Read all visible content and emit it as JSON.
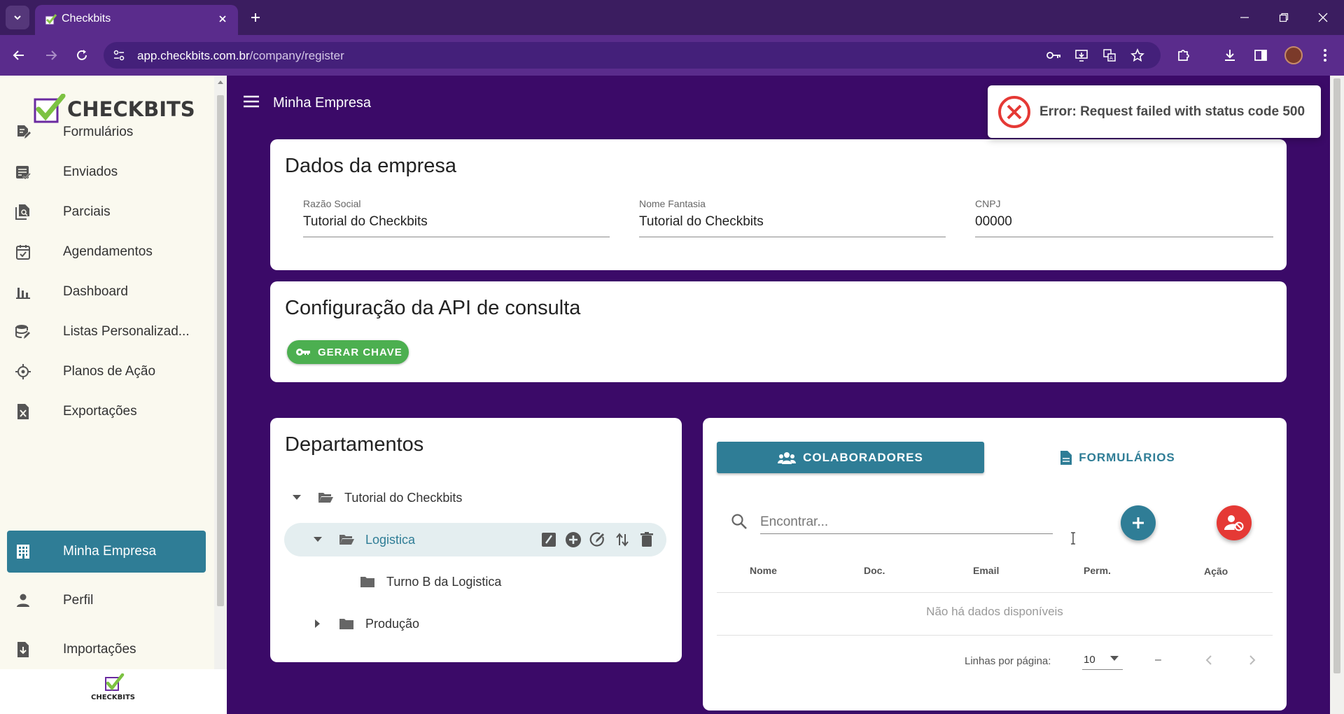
{
  "browser": {
    "tab_title": "Checkbits",
    "url_host": "app.checkbits.com.br",
    "url_path": "/company/register"
  },
  "sidebar": {
    "brand": "CHECKBITS",
    "items": [
      {
        "label": "Formulários",
        "icon": "form-edit-icon"
      },
      {
        "label": "Enviados",
        "icon": "sent-list-icon"
      },
      {
        "label": "Parciais",
        "icon": "partial-docs-icon"
      },
      {
        "label": "Agendamentos",
        "icon": "calendar-check-icon"
      },
      {
        "label": "Dashboard",
        "icon": "bar-chart-icon"
      },
      {
        "label": "Listas Personalizad...",
        "icon": "database-edit-icon"
      },
      {
        "label": "Planos de Ação",
        "icon": "crosshair-icon"
      },
      {
        "label": "Exportações",
        "icon": "excel-file-icon"
      },
      {
        "label": "Minha Empresa",
        "icon": "building-icon",
        "active": true
      },
      {
        "label": "Perfil",
        "icon": "person-icon"
      },
      {
        "label": "Importações",
        "icon": "file-import-icon"
      }
    ],
    "bottom_logo": "CHECKBITS"
  },
  "header": {
    "title": "Minha Empresa"
  },
  "company": {
    "title": "Dados da empresa",
    "fields": [
      {
        "label": "Razão Social",
        "value": "Tutorial do Checkbits"
      },
      {
        "label": "Nome Fantasia",
        "value": "Tutorial do Checkbits"
      },
      {
        "label": "CNPJ",
        "value": "00000"
      }
    ]
  },
  "api": {
    "title": "Configuração da API de consulta",
    "generate_button": "GERAR CHAVE"
  },
  "departments": {
    "title": "Departamentos",
    "tree": [
      {
        "label": "Tutorial do Checkbits",
        "expanded": true,
        "level": 0
      },
      {
        "label": "Logistica",
        "expanded": true,
        "level": 1,
        "selected": true
      },
      {
        "label": "Turno B da Logistica",
        "level": 2,
        "leaf": true
      },
      {
        "label": "Produção",
        "expanded": false,
        "level": 1
      }
    ]
  },
  "panel": {
    "tabs": [
      {
        "label": "COLABORADORES",
        "active": true
      },
      {
        "label": "FORMULÁRIOS",
        "active": false
      }
    ],
    "search_placeholder": "Encontrar...",
    "columns": [
      "Nome",
      "Doc.",
      "Email",
      "Perm.",
      "Ação"
    ],
    "empty_text": "Não há dados disponíveis",
    "rows_per_page_label": "Linhas por página:",
    "rows_per_page": "10",
    "page_range": "–"
  },
  "toast": {
    "message": "Error: Request failed with status code 500"
  },
  "colors": {
    "page_bg": "#3b0a68",
    "accent": "#2f7d96",
    "success": "#4caf50",
    "danger": "#e53935"
  }
}
